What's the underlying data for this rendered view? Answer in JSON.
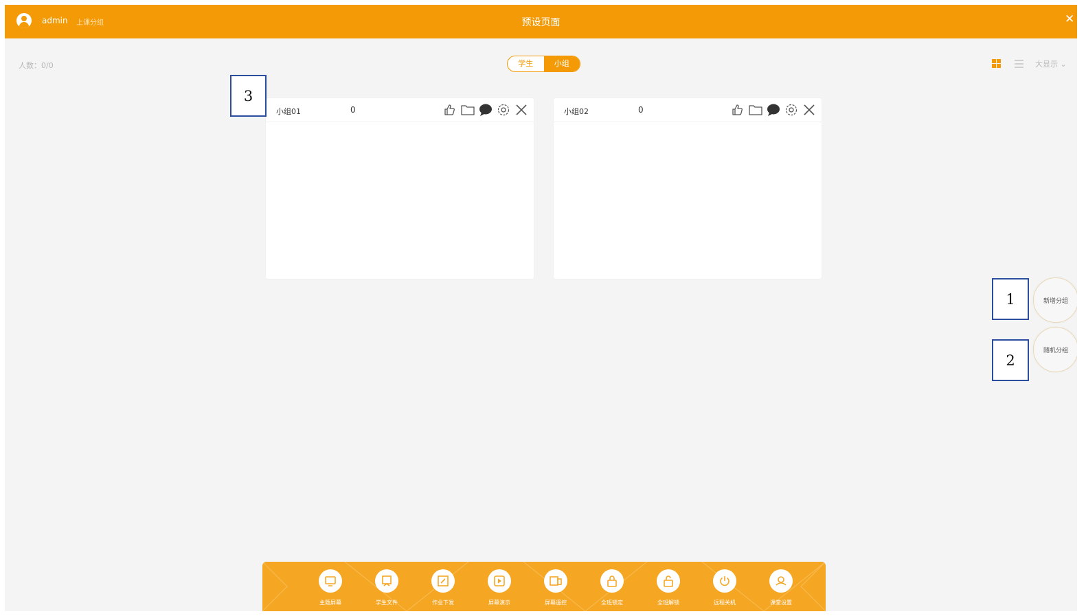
{
  "header": {
    "username": "admin",
    "role": "上课分组",
    "title": "预设页面"
  },
  "count": {
    "label": "人数：0/0"
  },
  "mode_switch": {
    "options": [
      "学生",
      "小组"
    ],
    "selected": "小组"
  },
  "view": {
    "mode": "grid",
    "size_label": "大显示 ⌄"
  },
  "groups": [
    {
      "name": "小组01",
      "score": "0"
    },
    {
      "name": "小组02",
      "score": "0"
    }
  ],
  "group_actions": [
    "thumbs-up-icon",
    "folder-icon",
    "comment-icon",
    "settings-icon",
    "close-icon"
  ],
  "fabs": {
    "add_group": "新增分组",
    "random_group": "随机分组"
  },
  "annotations": {
    "a1": "1",
    "a2": "2",
    "a3": "3"
  },
  "toolbar": {
    "items": [
      {
        "label": "主题屏幕",
        "icon": "screen-icon"
      },
      {
        "label": "学生文件",
        "icon": "whiteboard-icon"
      },
      {
        "label": "作业下发",
        "icon": "edit-icon"
      },
      {
        "label": "屏幕演示",
        "icon": "play-icon"
      },
      {
        "label": "屏幕遥控",
        "icon": "remote-icon"
      },
      {
        "label": "全班锁定",
        "icon": "lock-icon"
      },
      {
        "label": "全班解锁",
        "icon": "unlock-icon"
      },
      {
        "label": "远程关机",
        "icon": "power-icon"
      },
      {
        "label": "课堂设置",
        "icon": "setting-icon"
      }
    ]
  },
  "colors": {
    "accent": "#f39a06",
    "background": "#f4f4f4",
    "annotation_border": "#2b4da0"
  }
}
